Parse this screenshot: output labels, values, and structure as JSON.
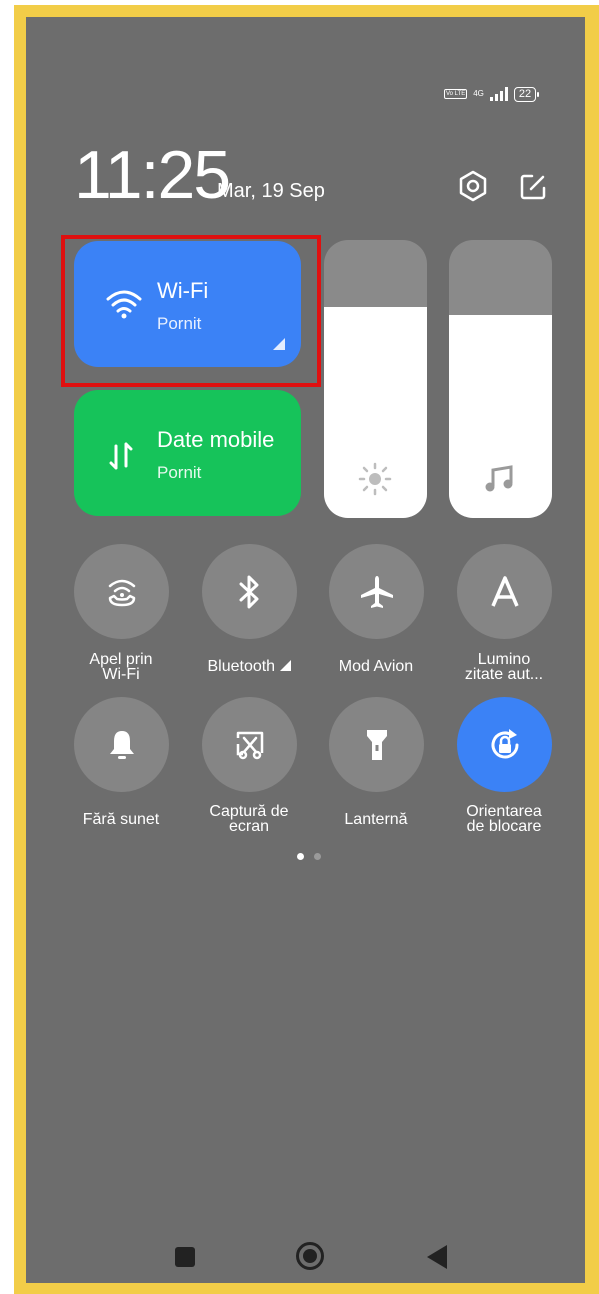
{
  "status_bar": {
    "volte": "Vo LTE",
    "network": "4G",
    "battery": "22"
  },
  "header": {
    "time": "11:25",
    "date": "Mar, 19 Sep"
  },
  "tiles": {
    "wifi": {
      "title": "Wi-Fi",
      "status": "Pornit",
      "color": "#3b82f6"
    },
    "mobile_data": {
      "title": "Date mobile",
      "status": "Pornit",
      "color": "#16c35a"
    }
  },
  "sliders": {
    "brightness_level": 0.76,
    "volume_level": 0.73
  },
  "toggles": [
    {
      "label": "Apel prin Wi-Fi",
      "icon": "wifi-call-icon"
    },
    {
      "label": "Bluetooth",
      "icon": "bluetooth-icon"
    },
    {
      "label": "Mod Avion",
      "icon": "airplane-icon"
    },
    {
      "label": "Lumino zitate aut...",
      "icon": "auto-brightness-icon"
    },
    {
      "label": "Fără sunet",
      "icon": "bell-icon"
    },
    {
      "label": "Captură de ecran",
      "icon": "screenshot-icon"
    },
    {
      "label": "Lanternă",
      "icon": "flashlight-icon"
    },
    {
      "label": "Orientarea de blocare",
      "icon": "rotation-lock-icon"
    }
  ],
  "toggle_labels": {
    "t0_l1": "Apel prin",
    "t0_l2": "Wi-Fi",
    "t1": "Bluetooth",
    "t2": "Mod Avion",
    "t3_l1": "Lumino",
    "t3_l2": "zitate aut...",
    "t4": "Fără sunet",
    "t5_l1": "Captură de",
    "t5_l2": "ecran",
    "t6": "Lanternă",
    "t7_l1": "Orientarea",
    "t7_l2": "de blocare"
  },
  "page_indicator": {
    "current": 1,
    "total": 2
  },
  "colors": {
    "background": "#6d6d6d",
    "button": "#858585",
    "active_button": "#3b82f6",
    "highlight": "#e01010",
    "frame": "#f2cd48"
  }
}
